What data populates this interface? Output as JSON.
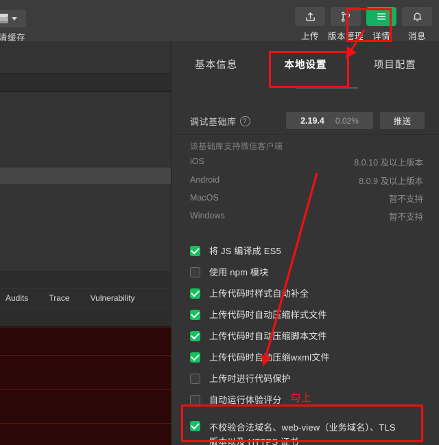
{
  "devtools": {
    "cache_button_label": "清缓存",
    "cache_icon": "layers-icon",
    "tabs": [
      "Audits",
      "Trace",
      "Vulnerability"
    ]
  },
  "toolbar": {
    "buttons": [
      {
        "label": "上传",
        "icon": "upload-icon",
        "active": false
      },
      {
        "label": "版本管理",
        "icon": "branch-icon",
        "active": false
      },
      {
        "label": "详情",
        "icon": "hamburger-icon",
        "active": true
      },
      {
        "label": "消息",
        "icon": "bell-icon",
        "active": false
      }
    ],
    "active_color": "#12b061"
  },
  "panel": {
    "tabs": [
      {
        "label": "基本信息",
        "selected": false
      },
      {
        "label": "本地设置",
        "selected": true
      },
      {
        "label": "项目配置",
        "selected": false
      }
    ],
    "debug_lib": {
      "label": "调试基础库",
      "help_icon": "question-mark-icon",
      "version": "2.19.4",
      "percent": "0.02%",
      "push_label": "推送"
    },
    "support_note": "该基础库支持微信客户端",
    "platforms": [
      {
        "name": "iOS",
        "value": "8.0.10 及以上版本"
      },
      {
        "name": "Android",
        "value": "8.0.9 及以上版本"
      },
      {
        "name": "MacOS",
        "value": "暂不支持"
      },
      {
        "name": "Windows",
        "value": "暂不支持"
      }
    ],
    "options": [
      {
        "label": "将 JS 编译成 ES5",
        "checked": true
      },
      {
        "label": "使用 npm 模块",
        "checked": false
      },
      {
        "label": "上传代码时样式自动补全",
        "checked": true
      },
      {
        "label": "上传代码时自动压缩样式文件",
        "checked": true
      },
      {
        "label": "上传代码时自动压缩脚本文件",
        "checked": true
      },
      {
        "label": "上传代码时自动压缩wxml文件",
        "checked": true
      },
      {
        "label": "上传时进行代码保护",
        "checked": false
      },
      {
        "label": "自动运行体验评分",
        "checked": false
      },
      {
        "label": "不校验合法域名、web-view（业务域名）、TLS 版本以及 HTTPS 证书",
        "checked": true
      }
    ]
  },
  "annotations": {
    "note_text": "勾上",
    "highlight_color": "#ee1111",
    "boxes": [
      "details-toolbar-button",
      "local-settings-tab",
      "skip-domain-check-option"
    ],
    "arrows": [
      "arrow-to-local-settings-tab",
      "arrow-to-wxml-compress-option"
    ]
  }
}
